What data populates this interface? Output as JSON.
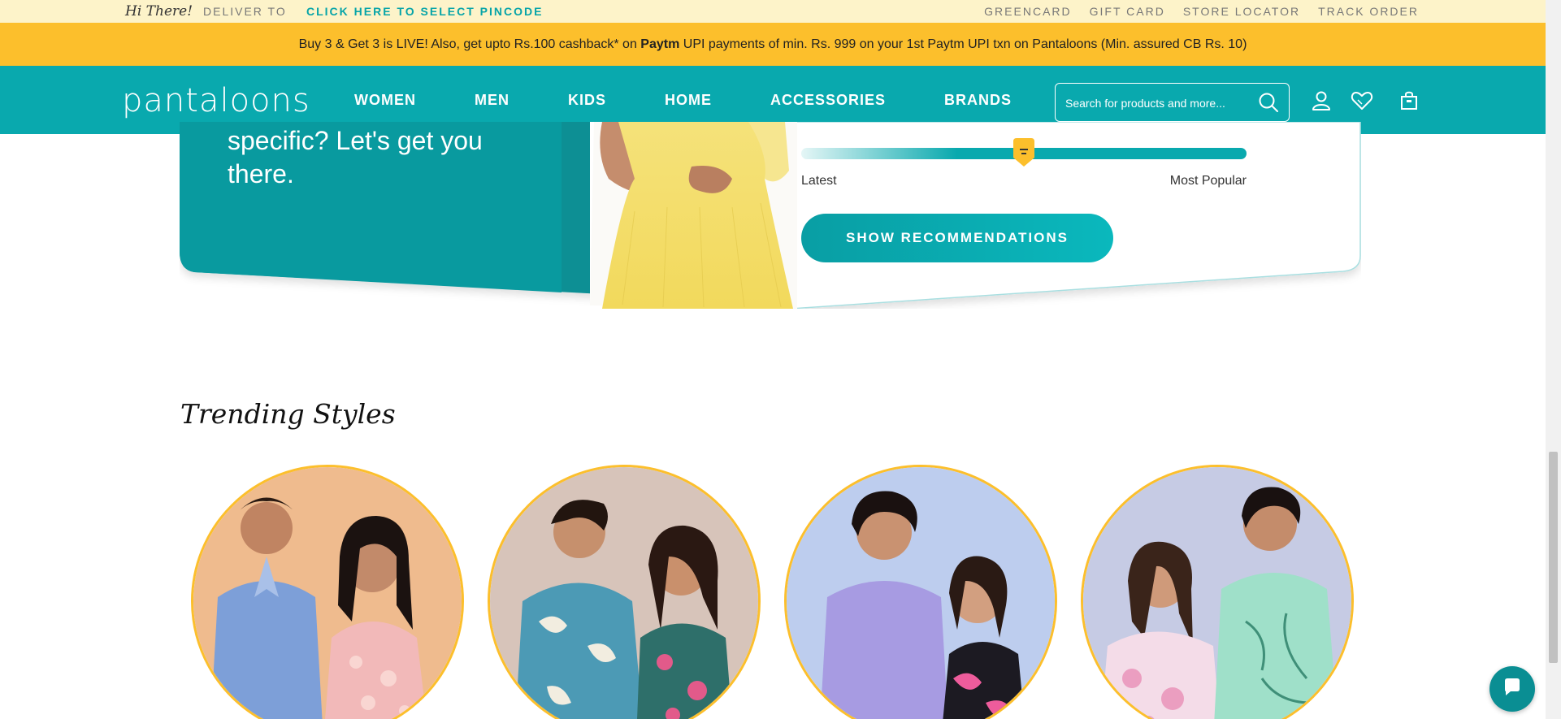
{
  "utility_bar": {
    "greeting": "Hi There!",
    "deliver_label": "DELIVER TO",
    "pincode_link": "CLICK HERE TO SELECT PINCODE",
    "links": [
      "GREENCARD",
      "GIFT CARD",
      "STORE LOCATOR",
      "TRACK ORDER"
    ]
  },
  "promo": {
    "text_before": "Buy 3 & Get 3 is LIVE! Also, get upto Rs.100 cashback* on ",
    "brand": "Paytm",
    "text_after": " UPI payments of min. Rs. 999 on your 1st Paytm UPI txn on Pantaloons (Min. assured CB Rs. 10)"
  },
  "nav": {
    "logo": "pantaloons",
    "items": [
      "WOMEN",
      "MEN",
      "KIDS",
      "HOME",
      "ACCESSORIES",
      "BRANDS"
    ],
    "search_placeholder": "Search for products and more...",
    "icons": [
      "user-icon",
      "heart-icon",
      "bag-icon",
      "search-icon"
    ]
  },
  "banner": {
    "line1": "specific? Let's get you",
    "line2": "there.",
    "slider": {
      "min_label": "Latest",
      "max_label": "Most Popular",
      "value": 0.5
    },
    "button_label": "SHOW RECOMMENDATIONS"
  },
  "trending": {
    "title": "Trending Styles"
  },
  "colors": {
    "teal": "#09a9ae",
    "yellow": "#fcbf2c",
    "cream": "#fdf3c9"
  }
}
